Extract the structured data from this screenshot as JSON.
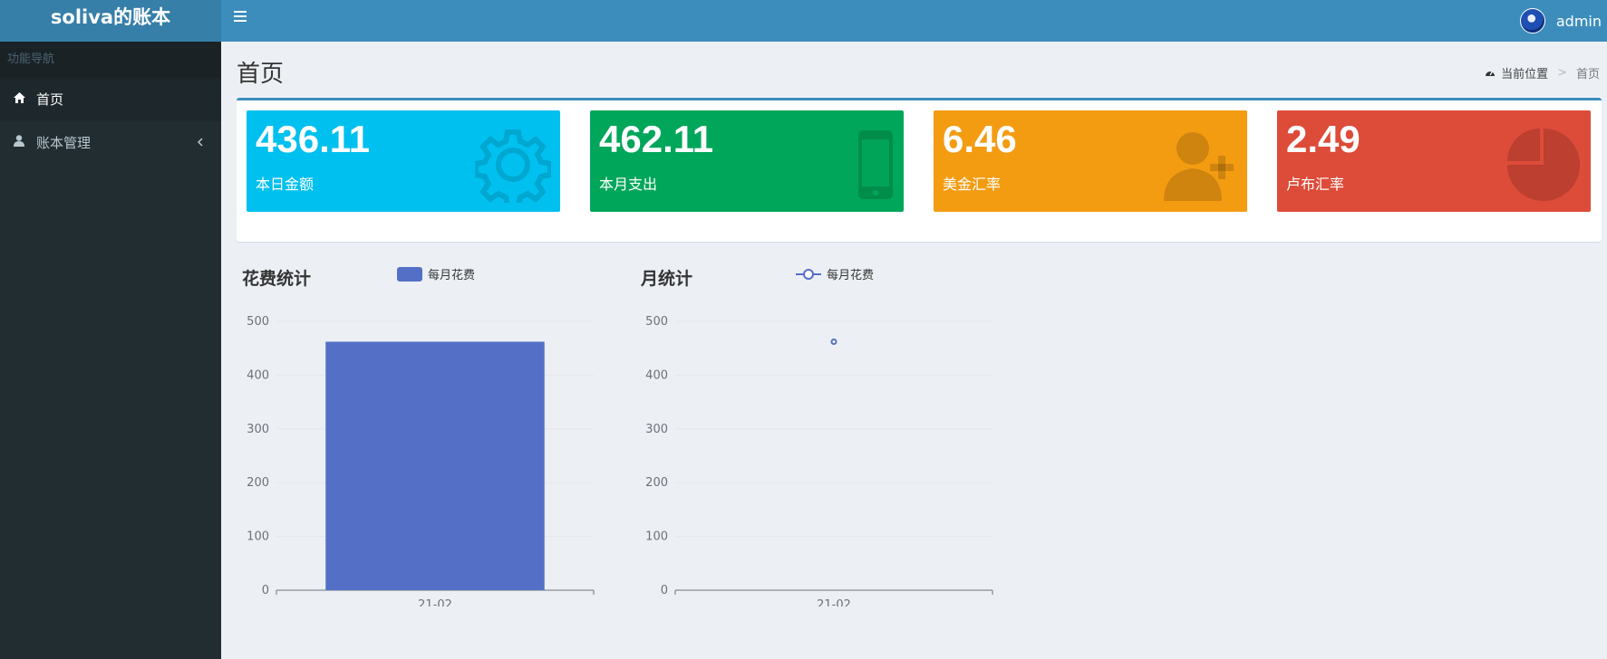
{
  "header": {
    "logo": "soliva的账本",
    "menu_icon": "bars-icon",
    "username": "admin"
  },
  "sidebar": {
    "section_title": "功能导航",
    "items": [
      {
        "label": "首页",
        "icon": "home-icon",
        "active": true
      },
      {
        "label": "账本管理",
        "icon": "user-icon",
        "active": false
      }
    ]
  },
  "page": {
    "title": "首页",
    "breadcrumb": {
      "location_label": "当前位置",
      "separator": ">",
      "current": "首页"
    }
  },
  "stats": [
    {
      "value": "436.11",
      "label": "本日金额",
      "color": "#00c0ef",
      "icon": "gear-icon"
    },
    {
      "value": "462.11",
      "label": "本月支出",
      "color": "#00a65a",
      "icon": "mobile-icon"
    },
    {
      "value": "6.46",
      "label": "美金汇率",
      "color": "#f39c12",
      "icon": "user-plus-icon"
    },
    {
      "value": "2.49",
      "label": "卢布汇率",
      "color": "#dd4b39",
      "icon": "pie-chart-icon"
    }
  ],
  "chart_data": [
    {
      "type": "bar",
      "title": "花费统计",
      "categories": [
        "21-02"
      ],
      "series": [
        {
          "name": "每月花费",
          "values": [
            462.11
          ]
        }
      ],
      "ylim": [
        0,
        500
      ],
      "yticks": [
        0,
        100,
        200,
        300,
        400,
        500
      ],
      "grid": true,
      "legend": "top",
      "color": "#5470c6"
    },
    {
      "type": "line",
      "title": "月统计",
      "categories": [
        "21-02"
      ],
      "series": [
        {
          "name": "每月花费",
          "values": [
            462.11
          ]
        }
      ],
      "ylim": [
        0,
        500
      ],
      "yticks": [
        0,
        100,
        200,
        300,
        400,
        500
      ],
      "grid": true,
      "legend": "top",
      "color": "#5470c6"
    }
  ]
}
